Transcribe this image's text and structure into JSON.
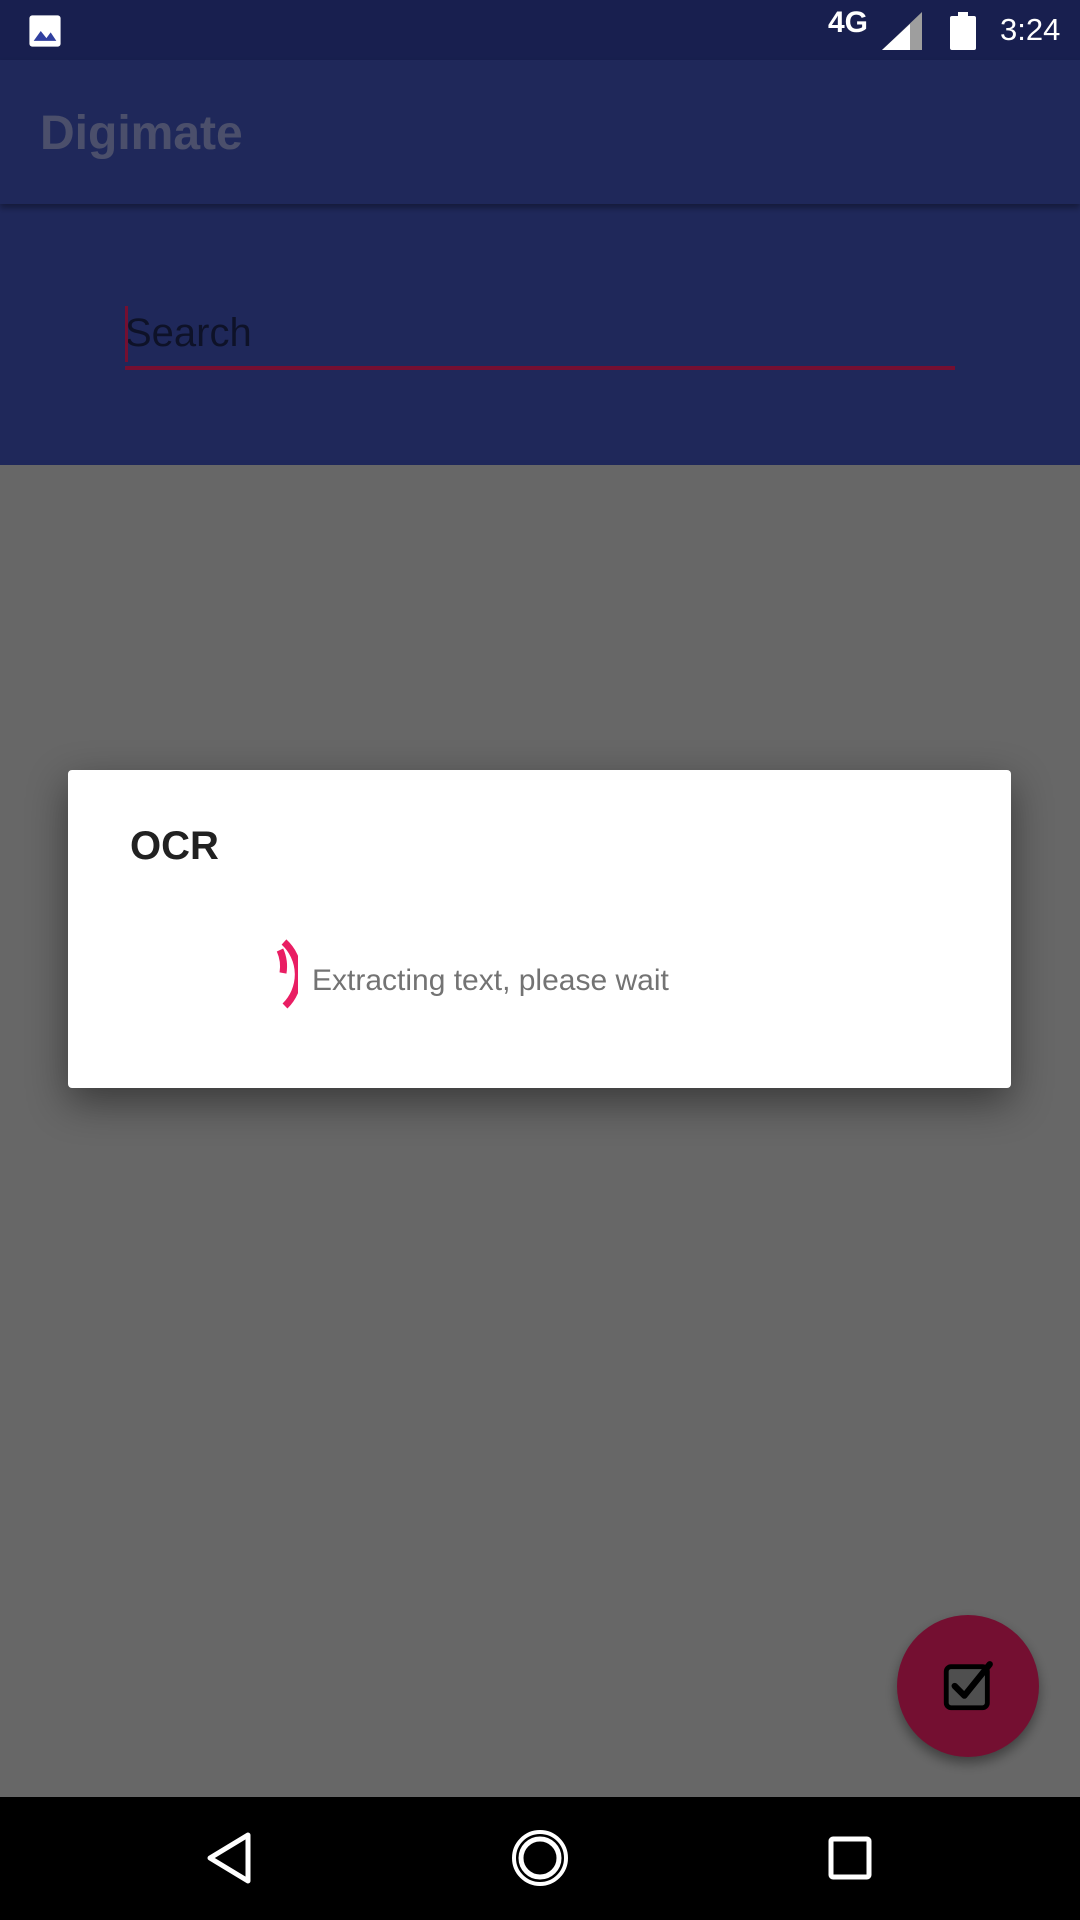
{
  "status_bar": {
    "network": "4G",
    "time": "3:24",
    "icons": [
      "gallery-icon",
      "signal-icon",
      "battery-icon"
    ]
  },
  "app_bar": {
    "title": "Digimate"
  },
  "search": {
    "placeholder": "Search",
    "value": ""
  },
  "dialog": {
    "title": "OCR",
    "message": "Extracting text, please wait"
  },
  "fab": {
    "icon": "checkbox-checked-icon"
  },
  "nav_bar": {
    "icons": [
      "back-icon",
      "home-icon",
      "recents-icon"
    ]
  },
  "colors": {
    "primary": "#3f51b5",
    "primary_dark": "#303f9f",
    "accent": "#e91e63",
    "scrim": "rgba(0,0,0,0.5)"
  }
}
